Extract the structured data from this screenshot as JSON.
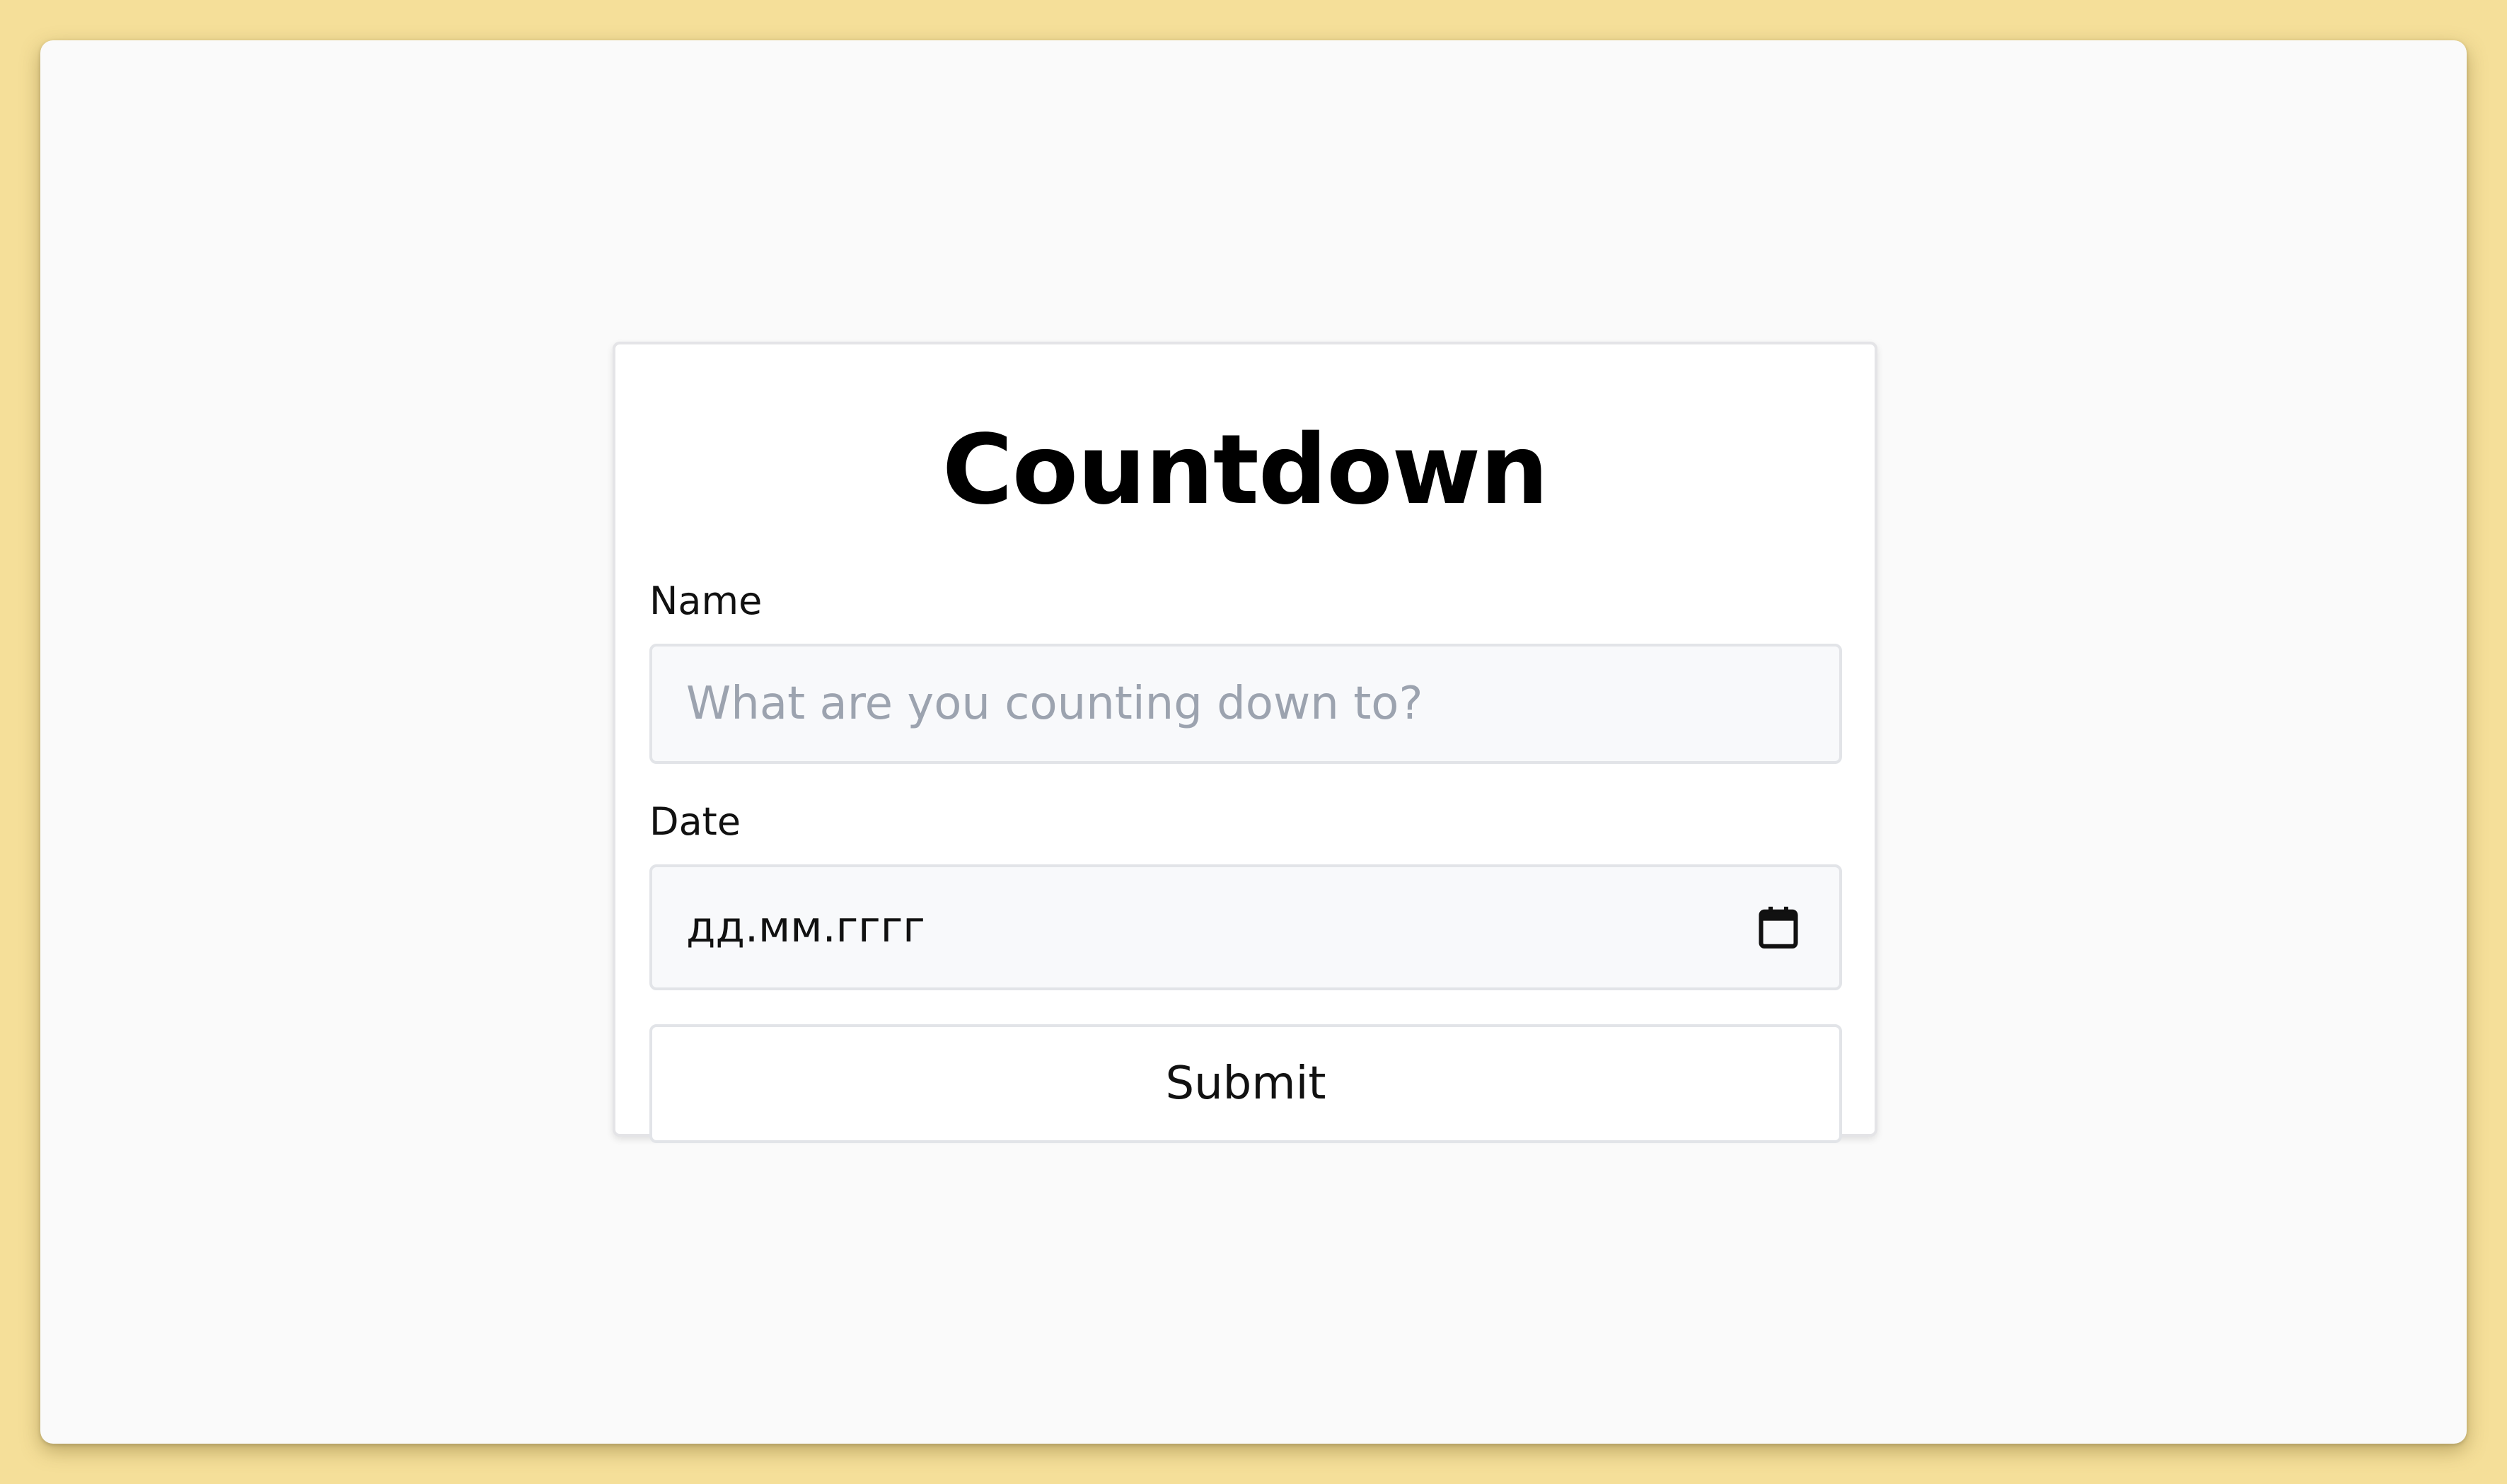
{
  "app": {
    "title": "Countdown"
  },
  "form": {
    "name": {
      "label": "Name",
      "placeholder": "What are you counting down to?",
      "value": ""
    },
    "date": {
      "label": "Date",
      "display": "дд.мм.гггг",
      "value": "",
      "icon": "calendar-icon"
    },
    "submit_label": "Submit"
  },
  "colors": {
    "outer_background": "#f5df99",
    "window_background": "#fafafa",
    "card_background": "#ffffff",
    "input_background": "#f8f9fb",
    "placeholder": "#9ca3af",
    "border": "#e2e4e8"
  }
}
